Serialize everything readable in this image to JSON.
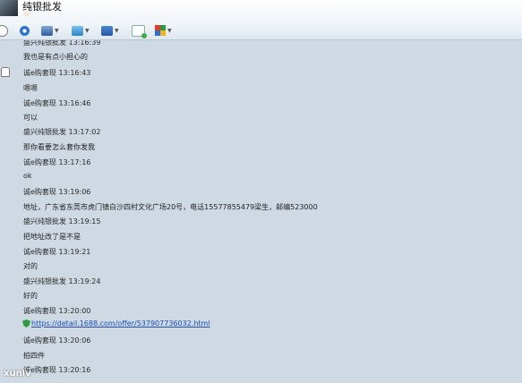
{
  "window": {
    "contact_name": "纯银批发",
    "star": "☆"
  },
  "toolbar": {
    "items": [
      {
        "icon": "smiley-icon"
      },
      {
        "icon": "circle-icon"
      },
      {
        "icon": "screenshot-icon"
      },
      {
        "icon": "send-file-icon"
      },
      {
        "icon": "remote-icon"
      },
      {
        "icon": "mail-icon"
      },
      {
        "icon": "apps-icon"
      }
    ]
  },
  "messages": [
    {
      "type": "meta",
      "text": "盛兴纯银批发 13:16:39"
    },
    {
      "type": "text",
      "text": "我也是有点小担心的"
    },
    {
      "type": "meta",
      "text": "诚e购套现 13:16:43"
    },
    {
      "type": "text",
      "text": "嗯嗯"
    },
    {
      "type": "meta",
      "text": "诚e购套现 13:16:46"
    },
    {
      "type": "text",
      "text": "可以"
    },
    {
      "type": "meta",
      "text": "盛兴纯银批发 13:17:02"
    },
    {
      "type": "text",
      "text": "那你看要怎么套你发我"
    },
    {
      "type": "meta",
      "text": "诚e购套现 13:17:16"
    },
    {
      "type": "text",
      "text": "ok"
    },
    {
      "type": "meta",
      "text": "诚e购套现 13:19:06"
    },
    {
      "type": "text",
      "text": "地址，广东省东莞市虎门镇白沙四村文化广场20号，电话15577855479梁生，邮编523000"
    },
    {
      "type": "meta",
      "text": "盛兴纯银批发 13:19:15"
    },
    {
      "type": "text",
      "text": "把地址改了是不是"
    },
    {
      "type": "meta",
      "text": "诚e购套现 13:19:21"
    },
    {
      "type": "text",
      "text": "对的"
    },
    {
      "type": "meta",
      "text": "盛兴纯银批发 13:19:24"
    },
    {
      "type": "text",
      "text": "好的"
    },
    {
      "type": "meta",
      "text": "诚e购套现 13:20:00"
    },
    {
      "type": "link",
      "text": "https://detail.1688.com/offer/537907736032.html"
    },
    {
      "type": "meta",
      "text": "诚e购套现 13:20:06"
    },
    {
      "type": "text",
      "text": "拍四件"
    },
    {
      "type": "meta",
      "text": "诚e购套现 13:20:16"
    }
  ],
  "watermark": "xunlv"
}
